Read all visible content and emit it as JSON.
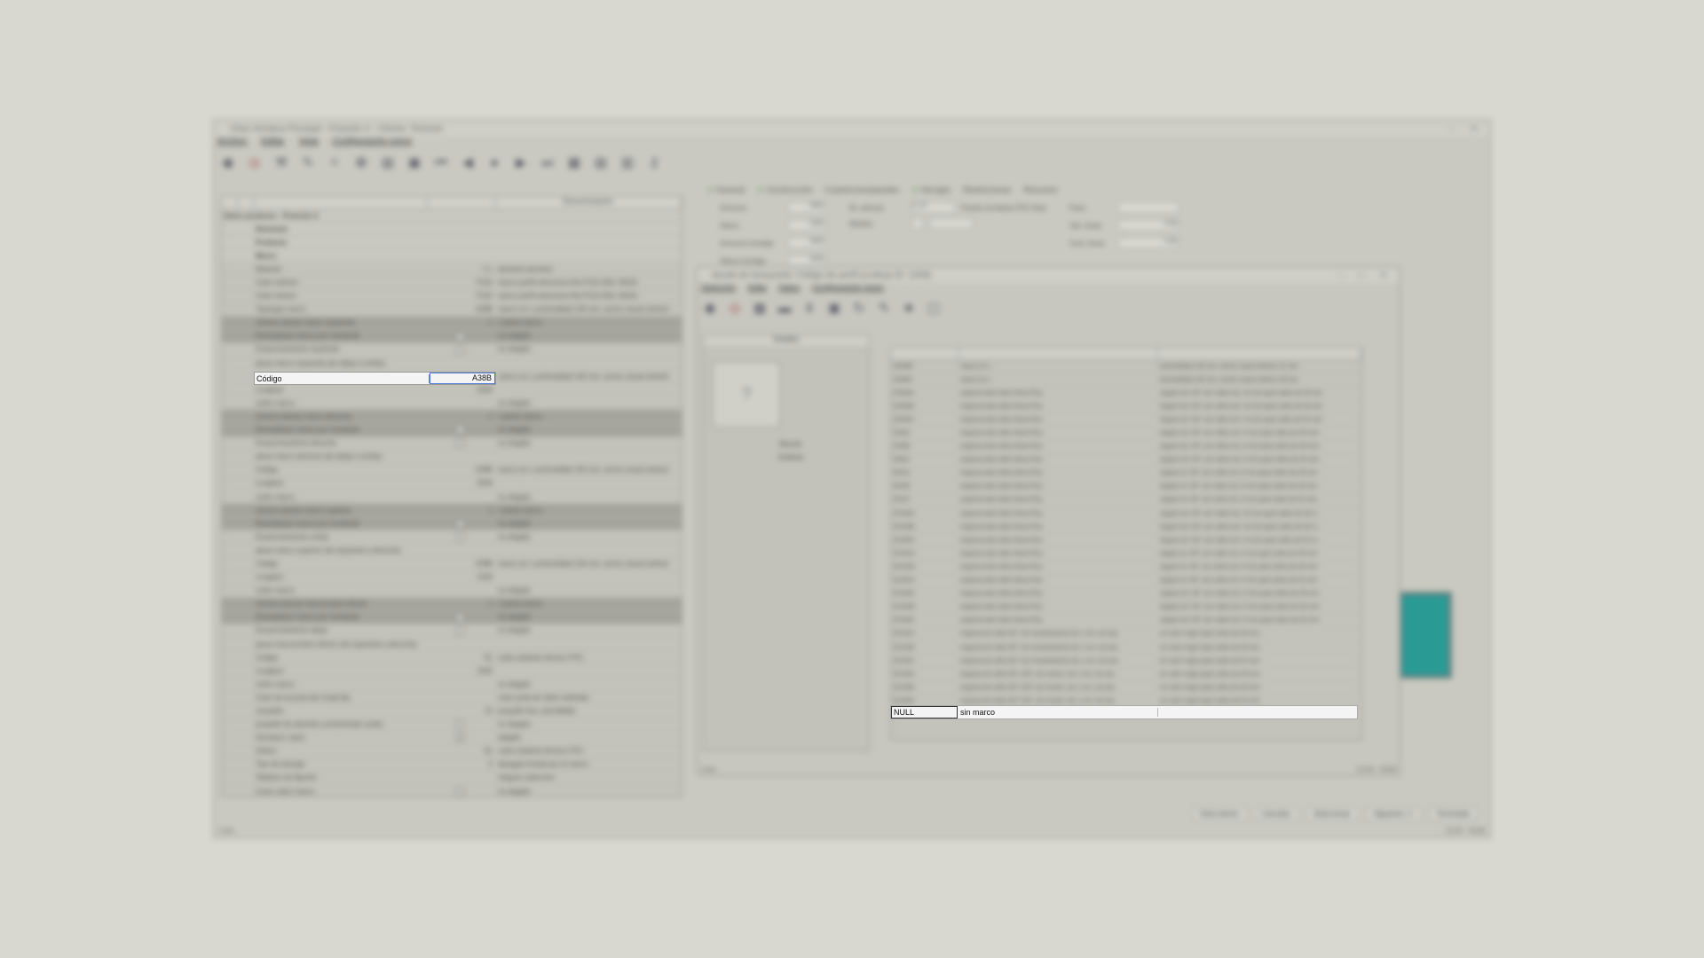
{
  "main": {
    "title": "Vista Ventana Principal - Posición 4 - Cliente: Testuser",
    "menu": [
      "Archivo",
      "Editar",
      "Vista",
      "Configuración menú"
    ],
    "toolbar_icons": [
      "exit-icon",
      "stop-icon",
      "tools-icon",
      "brush-icon",
      "magic-icon",
      "colors-icon",
      "doc-icon",
      "frame-icon",
      "first-icon",
      "prev-icon",
      "record-icon",
      "next-icon",
      "last-icon",
      "grid-icon",
      "table-icon",
      "layout-icon",
      "key-icon"
    ],
    "left_header": [
      "",
      "",
      "",
      "Denominación"
    ],
    "left_title": "Datos producto · Posición 4",
    "left_rows": [
      {
        "k": "Elemento",
        "v": "",
        "d": "",
        "type": "section"
      },
      {
        "k": "Producto",
        "v": "",
        "d": "",
        "type": "section"
      },
      {
        "k": "Marco",
        "v": "",
        "d": "",
        "type": "section"
      },
      {
        "k": "Material",
        "v": "1.1",
        "d": "aluminio aluminio",
        "type": "normal"
      },
      {
        "k": "Color exterior",
        "v": "P110",
        "d": "marco perfil estructura fina P110 (Ral. 9016)",
        "type": "normal"
      },
      {
        "k": "Color interior",
        "v": "P110",
        "d": "marco perfil estructura fina P110 (Ral. 9016)",
        "type": "normal"
      },
      {
        "k": "Tipología marco",
        "v": "A38B",
        "d": "marco en L profundidad 100 mm, ancho visual exterior",
        "type": "normal"
      },
      {
        "k": "número piezas marco izquierda",
        "v": "1",
        "d": "1 pieza marco",
        "type": "dark"
      },
      {
        "k": "Reemplazar marco por montante",
        "v": "chk",
        "d": "no elegido",
        "type": "dark"
      },
      {
        "k": "Ensanchamiento izquierda",
        "v": "chk",
        "d": "no elegido",
        "type": "normal"
      },
      {
        "k": "pieza marco izquierda (de abajo a arriba)",
        "v": "",
        "d": "",
        "type": "normal"
      },
      {
        "k": "",
        "v": "",
        "d": "marco en L profundidad 100 mm, ancho visual exterior",
        "type": "placeholder"
      },
      {
        "k": "Longitud",
        "v": "2000",
        "d": "",
        "type": "normal"
      },
      {
        "k": "unión marco",
        "v": "",
        "d": "no elegido",
        "type": "normal"
      },
      {
        "k": "número piezas marco derecha",
        "v": "1",
        "d": "1 pieza marco",
        "type": "dark"
      },
      {
        "k": "Reemplazar marco por montante",
        "v": "chk",
        "d": "no elegido",
        "type": "dark"
      },
      {
        "k": "Ensanchamiento derecha",
        "v": "chk",
        "d": "no elegido",
        "type": "normal"
      },
      {
        "k": "pieza marco derecha (de abajo a arriba)",
        "v": "",
        "d": "",
        "type": "normal"
      },
      {
        "k": "Código",
        "v": "A38B",
        "d": "marco en L profundidad 100 mm, ancho visual exterior",
        "type": "normal"
      },
      {
        "k": "Longitud",
        "v": "2000",
        "d": "",
        "type": "normal"
      },
      {
        "k": "unión marco",
        "v": "",
        "d": "no elegido",
        "type": "normal"
      },
      {
        "k": "número piezas marco superior",
        "v": "1",
        "d": "1 pieza marco",
        "type": "dark"
      },
      {
        "k": "Reemplazar marco por montante",
        "v": "chk",
        "d": "no elegido",
        "type": "dark"
      },
      {
        "k": "Ensanchamiento arriba",
        "v": "chk",
        "d": "no elegido",
        "type": "normal"
      },
      {
        "k": "pieza marco superior (de izquierda a derecha)",
        "v": "",
        "d": "",
        "type": "normal"
      },
      {
        "k": "Código",
        "v": "A38B",
        "d": "marco en L profundidad 100 mm, ancho visual exterior",
        "type": "normal"
      },
      {
        "k": "Longitud",
        "v": "1500",
        "d": "",
        "type": "normal"
      },
      {
        "k": "unión marco",
        "v": "",
        "d": "no elegido",
        "type": "normal"
      },
      {
        "k": "número piezas marco/cubre inferior",
        "v": "1",
        "d": "1 pieza marco",
        "type": "dark"
      },
      {
        "k": "Reemplazar marco por montante",
        "v": "chk",
        "d": "no elegido",
        "type": "dark"
      },
      {
        "k": "Ensanchamiento abajo",
        "v": "chk",
        "d": "no elegido",
        "type": "normal"
      },
      {
        "k": "pieza marco/cubre inferior (de izquierda a derecha)",
        "v": "",
        "d": "",
        "type": "normal"
      },
      {
        "k": "Código",
        "v": "S1",
        "d": "cubre aislante térmico PVC",
        "type": "normal"
      },
      {
        "k": "Longitud",
        "v": "1500",
        "d": "",
        "type": "normal"
      },
      {
        "k": "unión marco",
        "v": "",
        "d": "no elegido",
        "type": "normal"
      },
      {
        "k": "Color de la junta del cristal fijo",
        "v": "",
        "d": "color junta de vidrio estándar",
        "type": "normal"
      },
      {
        "k": "Junquillo",
        "v": "10",
        "d": "junquillo fina, atornillable",
        "type": "normal"
      },
      {
        "k": "junquillo de aluminio suministrado suelto",
        "v": "chk",
        "d": "no elegido",
        "type": "normal"
      },
      {
        "k": "Introducir cubre",
        "v": "chkon",
        "d": "elegido",
        "type": "normal"
      },
      {
        "k": "Solera",
        "v": "S1",
        "d": "cubre aislante térmico PVC",
        "type": "normal"
      },
      {
        "k": "Tipo de drenaje",
        "v": "0",
        "d": "desagüe frontal por el marco",
        "type": "normal"
      },
      {
        "k": "Taladros de fijación",
        "v": "",
        "d": "ninguno seleccion",
        "type": "normal"
      },
      {
        "k": "Corte cubre marco",
        "v": "chk",
        "d": "no elegido",
        "type": "normal"
      }
    ],
    "tabs": [
      {
        "label": "General",
        "ok": true
      },
      {
        "label": "Construcción",
        "ok": true
      },
      {
        "label": "Cuarterones/paneles",
        "ok": false
      },
      {
        "label": "Herrajes",
        "ok": true
      },
      {
        "label": "Restricciones",
        "ok": false
      },
      {
        "label": "Resumen",
        "ok": false
      }
    ],
    "general": {
      "ancho_label": "Anchura",
      "ancho_value": "3000",
      "alto_label": "Altura",
      "alto_value": "2000",
      "anchura_mirilla_label": "Anchura montaje",
      "anchura_mirilla_value": "3000",
      "altura_mirilla_label": "Altura montaje",
      "altura_mirilla_value": "2000",
      "articulo_label": "Nr. artículo",
      "articulo_value": "V_01",
      "articulo_desc": "Puerta corredera PSI-Vista",
      "modelo_label": "Modelo",
      "peso_label": "Peso",
      "ven_bruto_label": "Ven. bruto",
      "ven_bruto_value": "0.00",
      "com_bruto_label": "Com. bruto",
      "com_bruto_value": "0.00"
    },
    "status_left": "Listo",
    "status_right": [
      "12:00",
      "NUM"
    ],
    "bottom_buttons": [
      "Vista interior",
      "Cancelar",
      "Seleccionar",
      "Siguiente >>",
      "Terminado"
    ]
  },
  "codigo_row": {
    "label": "Código",
    "value": "A38B"
  },
  "dialog": {
    "title": "Ayuda de búsqueda: Código de perfil (Lookup ID: 1048)",
    "menu": [
      "Selección",
      "Edita",
      "Datos",
      "Configuración menú"
    ],
    "details_title": "Detalles",
    "image_placeholder": "?",
    "buscar_label": "Buscar",
    "ordenar_label": "Ordenar",
    "rows": [
      {
        "code": "A038B",
        "desc": "marco en L",
        "extra": "profundidad 100 mm, ancho visual exterior 31 mm"
      },
      {
        "code": "A038C",
        "desc": "marco en L",
        "extra": "profundidad 100 mm, ancho visual exterior 38 mm"
      },
      {
        "code": "ES0AA",
        "desc": "esquina todo vidrio Nova Plus",
        "extra": "ángulo ext. 90° con vidrio ext. 10 mm para vidrio de 30 mm"
      },
      {
        "code": "ES0AB",
        "desc": "esquina todo vidrio Nova Plus",
        "extra": "ángulo ext. 90° con vidrio ext. 10 mm para vidrio de 40 mm"
      },
      {
        "code": "ES0AC",
        "desc": "esquina todo vidrio Nova Plus",
        "extra": "ángulo ext. 90° con vidrio ext. 10 mm para vidrio de 52 mm"
      },
      {
        "code": "ES0A",
        "desc": "esquina todo vidrio Nova Plus",
        "extra": "ángulo ext. 90° con vidrio ext. 6 mm para vidrio de 30 mm"
      },
      {
        "code": "ES0B",
        "desc": "esquina todo vidrio Nova Plus",
        "extra": "ángulo ext. 90° con vidrio ext. 6 mm para vidrio de 40 mm"
      },
      {
        "code": "ES0C",
        "desc": "esquina todo vidrio Nova Plus",
        "extra": "ángulo ext. 90° con vidrio ext. 6 mm para vidrio de 52 mm"
      },
      {
        "code": "ES2A",
        "desc": "esquina todo vidrio Nova Plus",
        "extra": "ángulo int. 90° con vidrio ext. 6 mm para vidrio de 30 mm"
      },
      {
        "code": "ES2B",
        "desc": "esquina todo vidrio Nova Plus",
        "extra": "ángulo int. 90° con vidrio ext. 6 mm para vidrio de 40 mm"
      },
      {
        "code": "ES2C",
        "desc": "esquina todo vidrio Nova Plus",
        "extra": "ángulo int. 90° con vidrio ext. 6 mm para vidrio de 52 mm"
      },
      {
        "code": "EUD0A",
        "desc": "esquina todo vidrio Nova Plus",
        "extra": "ángulo ext. 90° con vidrio ext. 10 mm para vidrio de 30 m"
      },
      {
        "code": "EUD0B",
        "desc": "esquina todo vidrio Nova Plus",
        "extra": "ángulo ext. 90° con vidrio ext. 10 mm para vidrio de 40 m"
      },
      {
        "code": "EUD0C",
        "desc": "esquina todo vidrio Nova Plus",
        "extra": "ángulo ext. 90° con vidrio ext. 10 mm para vidrio de 52 m"
      },
      {
        "code": "EUD2A",
        "desc": "esquina todo vidrio Nova Plus",
        "extra": "ángulo int. 90° con vidrio ext. 6 mm para vidrio de 30 mm"
      },
      {
        "code": "EUD2B",
        "desc": "esquina todo vidrio Nova Plus",
        "extra": "ángulo int. 90° con vidrio ext. 6 mm para vidrio de 40 mm"
      },
      {
        "code": "EUD2C",
        "desc": "esquina todo vidrio Nova Plus",
        "extra": "ángulo int. 90° con vidrio ext. 6 mm para vidrio de 52 mm"
      },
      {
        "code": "EUD4A",
        "desc": "esquina todo vidrio Nova Plus",
        "extra": "ángulo ext. 90° con vidrio ext. 6 mm para vidrio de 30 mm"
      },
      {
        "code": "EUD4B",
        "desc": "esquina todo vidrio Nova Plus",
        "extra": "ángulo ext. 90° con vidrio ext. 6 mm para vidrio de 40 mm"
      },
      {
        "code": "EUD4C",
        "desc": "esquina todo vidrio Nova Plus",
        "extra": "ángulo ext. 90° con vidrio ext. 6 mm para vidrio de 52 mm"
      },
      {
        "code": "EUS2A",
        "desc": "esquina de vidrio 90° con revestimiento ext. o int. con alu.",
        "extra": "en color negro para vidrio de 30 mm"
      },
      {
        "code": "EUS2B",
        "desc": "esquina de vidrio 90° con revestimiento ext. o int. con alu.",
        "extra": "en color negro para vidrio de 40 mm"
      },
      {
        "code": "EUS2C",
        "desc": "esquina de vidrio 90° con revestimiento ext. o int. con alu.",
        "extra": "en color negro para vidrio de 52 mm"
      },
      {
        "code": "EUS3A",
        "desc": "esquina de vidrio 90°-135° con revest. ext. o int. con alu.",
        "extra": "en color negro para vidrio de 30 mm"
      },
      {
        "code": "EUS3B",
        "desc": "esquina de vidrio 90°-135° con revest. ext. o int. con alu.",
        "extra": "en color negro para vidrio de 40 mm"
      },
      {
        "code": "EUS3C",
        "desc": "esquina de vidrio 90°-135° con revest. ext. o int. con alu.",
        "extra": "en color negro para vidrio de 52 mm"
      }
    ],
    "selected_row": {
      "code": "NULL",
      "desc": "sin marco"
    },
    "status_left": "Listo",
    "status_right": [
      "12:00",
      "NUM"
    ]
  }
}
